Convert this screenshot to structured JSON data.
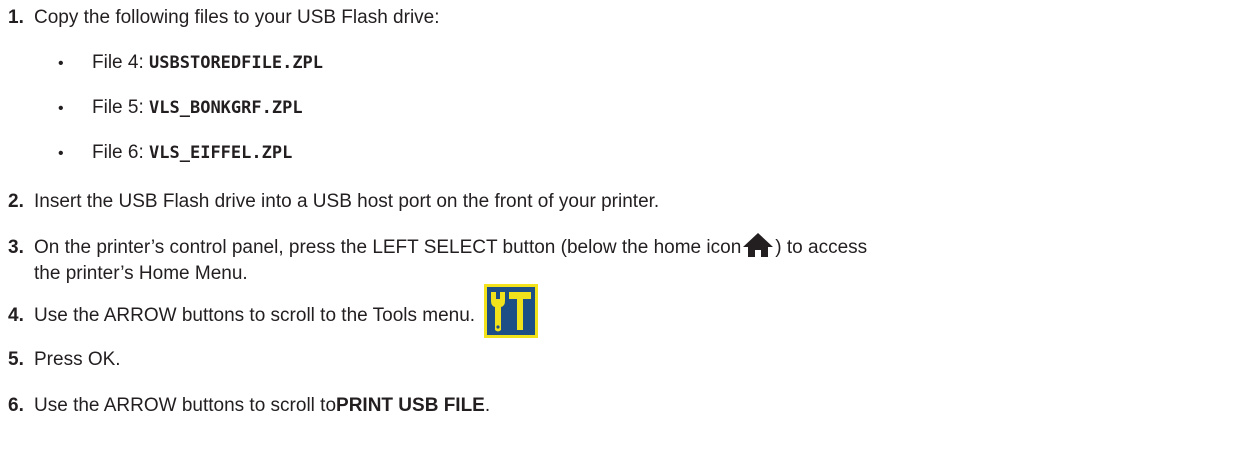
{
  "steps": [
    {
      "num": "1.",
      "text": "Copy the following files to your USB Flash drive:"
    },
    {
      "num": "2.",
      "text": "Insert the USB Flash drive into a USB host port on the front of your printer."
    },
    {
      "num": "3.",
      "text_before": "On the printer’s control panel, press the LEFT SELECT button (below the home icon",
      "text_after": ") to access",
      "text_cont": "the printer’s Home Menu."
    },
    {
      "num": "4.",
      "text": "Use the ARROW buttons to scroll to the Tools menu."
    },
    {
      "num": "5.",
      "text": "Press OK."
    },
    {
      "num": "6.",
      "text_before": "Use the ARROW buttons to scroll to ",
      "emph": "PRINT USB FILE",
      "text_after": "."
    }
  ],
  "files": [
    {
      "bullet": "•",
      "label": "File 4: ",
      "name": "USBSTOREDFILE.ZPL"
    },
    {
      "bullet": "•",
      "label": "File 5: ",
      "name": "VLS_BONKGRF.ZPL"
    },
    {
      "bullet": "•",
      "label": "File 6: ",
      "name": "VLS_EIFFEL.ZPL"
    }
  ],
  "icons": {
    "home": "home-icon",
    "tools": "tools-icon"
  },
  "colors": {
    "text": "#231f20",
    "tools_bg": "#1e4e86",
    "tools_fg": "#f2e21b"
  }
}
